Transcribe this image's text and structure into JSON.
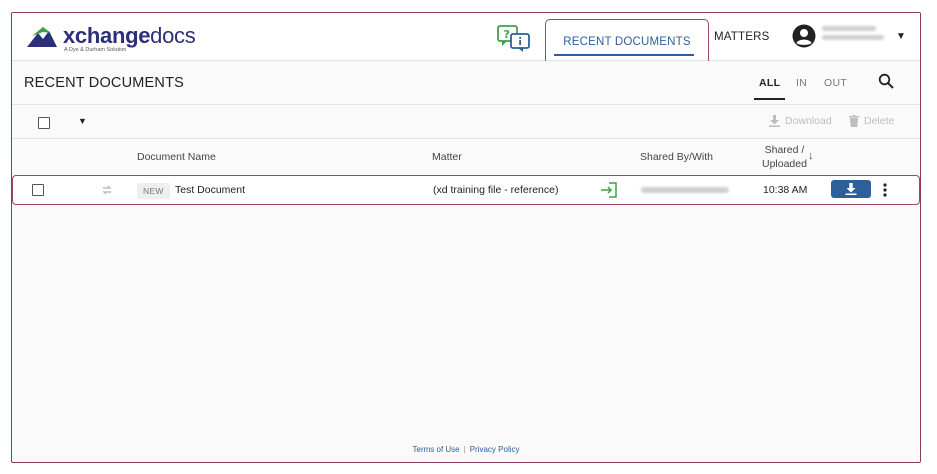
{
  "brand": {
    "name_bold": "xchange",
    "name_light": "docs",
    "tagline": "A Dye & Durham Solution",
    "colors": {
      "navy": "#2c2f7a",
      "green": "#3aa245",
      "accent_blue": "#2e5f9a",
      "highlight": "#9b4768"
    }
  },
  "nav": {
    "recent_documents": "RECENT DOCUMENTS",
    "matters": "MATTERS"
  },
  "page": {
    "title": "RECENT DOCUMENTS",
    "filters": {
      "all": "ALL",
      "in": "IN",
      "out": "OUT"
    }
  },
  "toolbar": {
    "download": "Download",
    "delete": "Delete"
  },
  "table": {
    "headers": {
      "document_name": "Document Name",
      "matter": "Matter",
      "shared_by_with": "Shared By/With",
      "shared_uploaded_line1": "Shared /",
      "shared_uploaded_line2": "Uploaded"
    },
    "rows": [
      {
        "badge": "NEW",
        "document_name": "Test Document",
        "matter": "(xd training file - reference)",
        "time": "10:38 AM"
      }
    ]
  },
  "footer": {
    "terms": "Terms of Use",
    "privacy": "Privacy Policy"
  }
}
